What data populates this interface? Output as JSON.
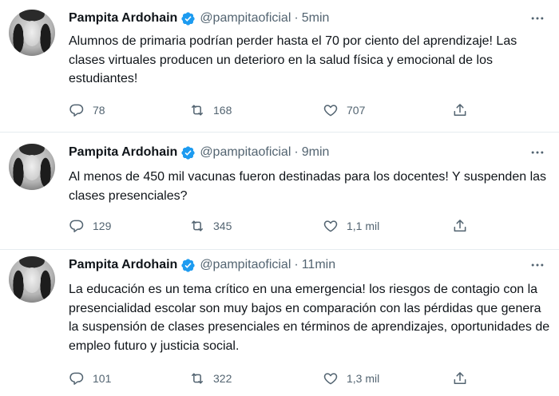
{
  "tweets": [
    {
      "author": "Pampita Ardohain",
      "handle": "@pampitaoficial",
      "separator": "·",
      "time": "5min",
      "text": "Alumnos de primaria podrían perder hasta el 70 por ciento del aprendizaje! Las clases virtuales producen un deterioro en la salud física y emocional de los estudiantes!",
      "replies": "78",
      "retweets": "168",
      "likes": "707"
    },
    {
      "author": "Pampita Ardohain",
      "handle": "@pampitaoficial",
      "separator": "·",
      "time": "9min",
      "text": "Al menos de 450 mil vacunas fueron destinadas para los docentes! Y suspenden las clases presenciales?",
      "replies": "129",
      "retweets": "345",
      "likes": "1,1 mil"
    },
    {
      "author": "Pampita Ardohain",
      "handle": "@pampitaoficial",
      "separator": "·",
      "time": "11min",
      "text": "La educación es un tema crítico en una emergencia! los riesgos de contagio con la presencialidad escolar son muy bajos en comparación con las pérdidas que genera la suspensión de clases presenciales en términos de aprendizajes, oportunidades de empleo futuro y justicia social.",
      "replies": "101",
      "retweets": "322",
      "likes": "1,3 mil"
    }
  ],
  "icons": {
    "verified": "verified-badge-icon",
    "more": "more-options-icon",
    "reply": "reply-icon",
    "retweet": "retweet-icon",
    "like": "like-icon",
    "share": "share-icon"
  },
  "colors": {
    "verified": "#1d9bf0",
    "secondary_text": "#536471",
    "primary_text": "#0f1419",
    "divider": "#e6ecf0"
  }
}
